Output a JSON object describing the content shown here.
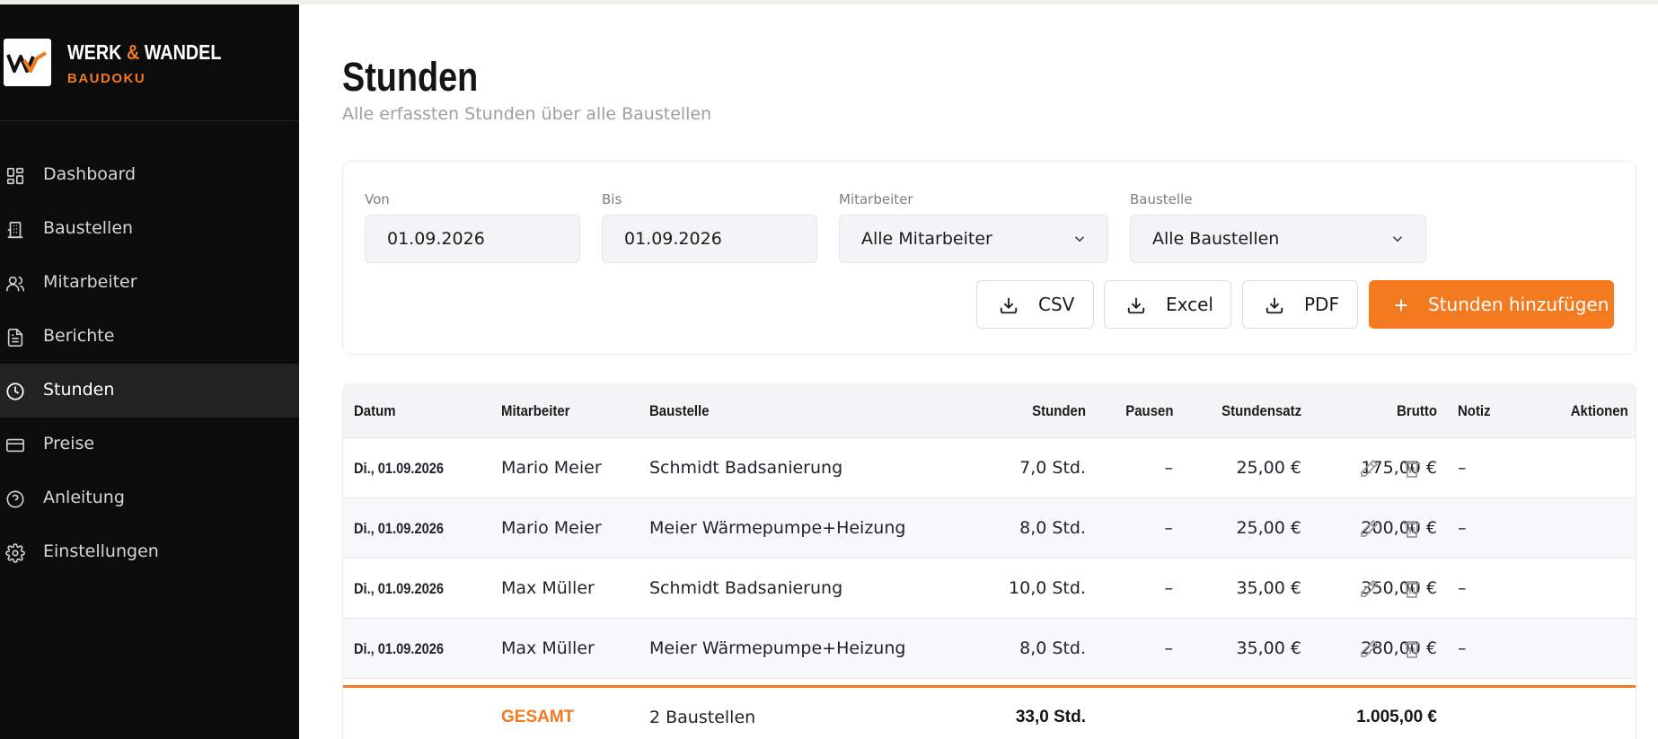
{
  "brand": {
    "name_part1": "WERK",
    "amp": "&",
    "name_part2": "WANDEL",
    "subtitle": "BAUDOKU"
  },
  "sidebar": {
    "items": [
      {
        "label": "Dashboard",
        "icon": "grid-icon",
        "active": false
      },
      {
        "label": "Baustellen",
        "icon": "building-icon",
        "active": false
      },
      {
        "label": "Mitarbeiter",
        "icon": "users-icon",
        "active": false
      },
      {
        "label": "Berichte",
        "icon": "file-text-icon",
        "active": false
      },
      {
        "label": "Stunden",
        "icon": "clock-icon",
        "active": true
      },
      {
        "label": "Preise",
        "icon": "credit-card-icon",
        "active": false
      },
      {
        "label": "Anleitung",
        "icon": "help-circle-icon",
        "active": false
      },
      {
        "label": "Einstellungen",
        "icon": "gear-icon",
        "active": false
      }
    ]
  },
  "page": {
    "title": "Stunden",
    "subtitle": "Alle erfassten Stunden über alle Baustellen"
  },
  "filters": {
    "von_label": "Von",
    "von_value": "01.09.2026",
    "bis_label": "Bis",
    "bis_value": "01.09.2026",
    "mitarbeiter_label": "Mitarbeiter",
    "mitarbeiter_value": "Alle Mitarbeiter",
    "baustelle_label": "Baustelle",
    "baustelle_value": "Alle Baustellen"
  },
  "actions": {
    "csv": "CSV",
    "excel": "Excel",
    "pdf": "PDF",
    "add": "Stunden hinzufügen"
  },
  "table": {
    "headers": {
      "datum": "Datum",
      "mitarbeiter": "Mitarbeiter",
      "baustelle": "Baustelle",
      "stunden": "Stunden",
      "pausen": "Pausen",
      "stundensatz": "Stundensatz",
      "brutto": "Brutto",
      "notiz": "Notiz",
      "aktionen": "Aktionen"
    },
    "rows": [
      {
        "datum": "Di., 01.09.2026",
        "mitarbeiter": "Mario Meier",
        "baustelle": "Schmidt Badsanierung",
        "stunden": "7,0 Std.",
        "pausen": "–",
        "stundensatz": "25,00 €",
        "brutto": "175,00 €",
        "notiz": "–"
      },
      {
        "datum": "Di., 01.09.2026",
        "mitarbeiter": "Mario Meier",
        "baustelle": "Meier Wärmepumpe+Heizung",
        "stunden": "8,0 Std.",
        "pausen": "–",
        "stundensatz": "25,00 €",
        "brutto": "200,00 €",
        "notiz": "–"
      },
      {
        "datum": "Di., 01.09.2026",
        "mitarbeiter": "Max Müller",
        "baustelle": "Schmidt Badsanierung",
        "stunden": "10,0 Std.",
        "pausen": "–",
        "stundensatz": "35,00 €",
        "brutto": "350,00 €",
        "notiz": "–"
      },
      {
        "datum": "Di., 01.09.2026",
        "mitarbeiter": "Max Müller",
        "baustelle": "Meier Wärmepumpe+Heizung",
        "stunden": "8,0 Std.",
        "pausen": "–",
        "stundensatz": "35,00 €",
        "brutto": "280,00 €",
        "notiz": "–"
      }
    ],
    "total": {
      "label": "GESAMT",
      "sites": "2 Baustellen",
      "stunden": "33,0 Std.",
      "brutto": "1.005,00 €"
    }
  },
  "colors": {
    "accent": "#f47a20",
    "sidebar_bg": "#0c0c0c",
    "sidebar_active": "#222222"
  }
}
